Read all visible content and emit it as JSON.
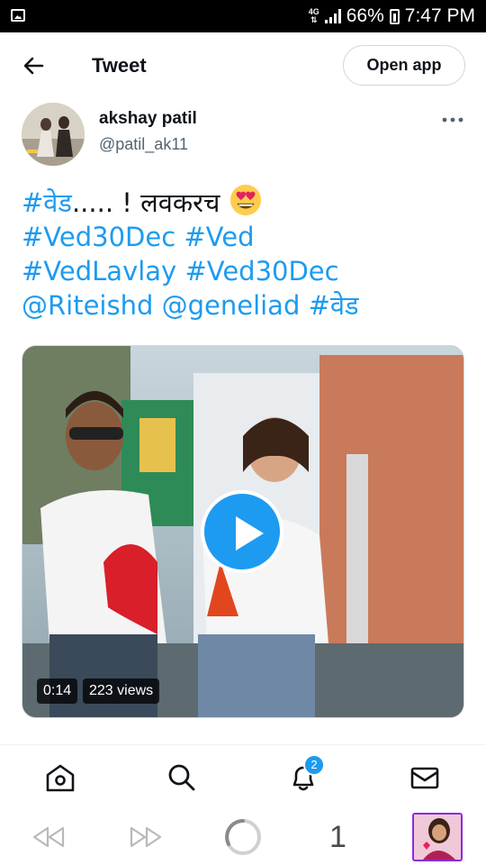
{
  "status_bar": {
    "network": "4G",
    "battery": "66%",
    "time": "7:47 PM"
  },
  "header": {
    "title": "Tweet",
    "open_app_label": "Open app"
  },
  "author": {
    "name": "akshay patil",
    "handle": "@patil_ak11"
  },
  "tweet": {
    "line1_hashtag": "#वेड",
    "line1_text": "..... ! लवकरच",
    "line2": [
      "#Ved30Dec",
      "#Ved"
    ],
    "line3": [
      "#VedLavlay",
      "#Ved30Dec"
    ],
    "line4": [
      "@Riteishd",
      "@geneliad",
      "#वेड"
    ],
    "emoji": "smiling-face-with-heart-eyes"
  },
  "media": {
    "duration": "0:14",
    "views": "223 views"
  },
  "nav": {
    "notification_count": "2"
  },
  "browser": {
    "tab_count": "1"
  },
  "colors": {
    "accent": "#1d9bf0",
    "text": "#0f1419",
    "secondary": "#536471"
  }
}
